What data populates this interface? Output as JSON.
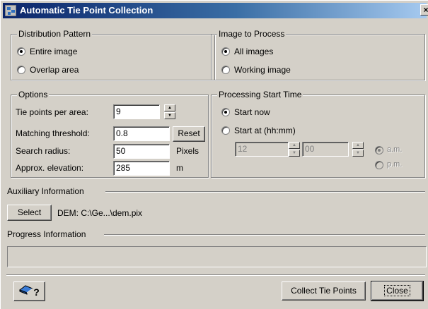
{
  "window": {
    "title": "Automatic Tie Point Collection",
    "close_glyph": "×",
    "icon": "app-icon"
  },
  "distribution": {
    "legend": "Distribution Pattern",
    "options": [
      {
        "label": "Entire image",
        "selected": true
      },
      {
        "label": "Overlap area",
        "selected": false
      }
    ]
  },
  "image_to_process": {
    "legend": "Image to Process",
    "options": [
      {
        "label": "All images",
        "selected": true
      },
      {
        "label": "Working image",
        "selected": false
      }
    ]
  },
  "options": {
    "legend": "Options",
    "tie_points_label": "Tie points per area:",
    "tie_points_value": "9",
    "matching_threshold_label": "Matching threshold:",
    "matching_threshold_value": "0.8",
    "reset_label": "Reset",
    "search_radius_label": "Search radius:",
    "search_radius_value": "50",
    "search_radius_unit": "Pixels",
    "elevation_label": "Approx. elevation:",
    "elevation_value": "285",
    "elevation_unit": "m"
  },
  "processing_start": {
    "legend": "Processing Start Time",
    "start_now_label": "Start now",
    "start_now_selected": true,
    "start_at_label": "Start at (hh:mm)",
    "start_at_selected": false,
    "hour_value": "12",
    "minute_value": "00",
    "am_label": "a.m.",
    "am_selected": true,
    "pm_label": "p.m.",
    "pm_selected": false
  },
  "auxiliary": {
    "label": "Auxiliary Information",
    "select_label": "Select",
    "dem_text": "DEM:  C:\\Ge...\\dem.pix"
  },
  "progress": {
    "label": "Progress Information",
    "fraction": 0
  },
  "footer": {
    "help_glyph": "?",
    "collect_label": "Collect Tie Points",
    "close_label": "Close"
  },
  "colors": {
    "face": "#d4d0c8",
    "title_start": "#0a246a",
    "title_end": "#a6caf0"
  }
}
